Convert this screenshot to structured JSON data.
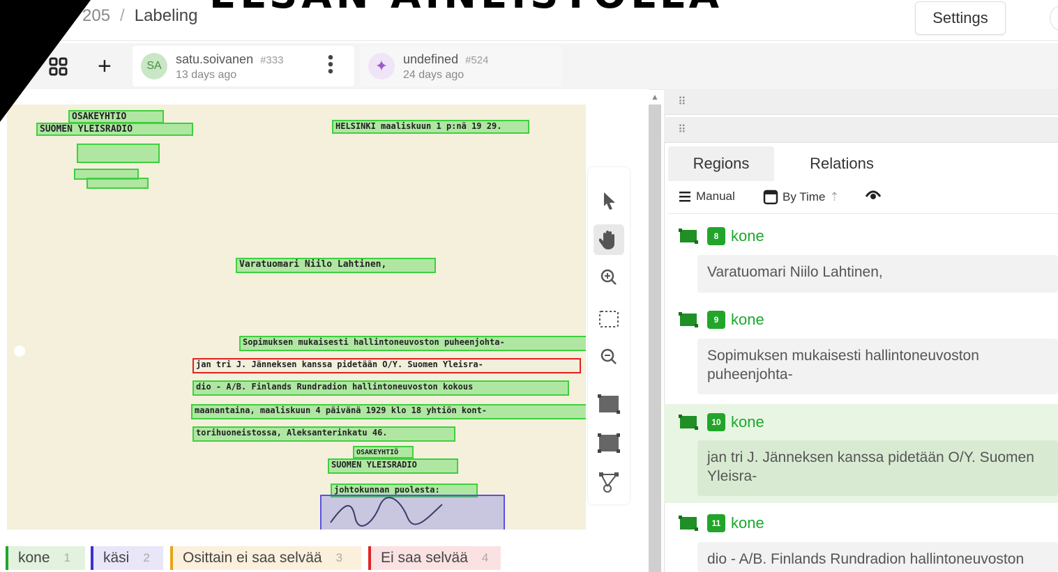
{
  "banner": "ELSAN AINEISTOLLA",
  "breadcrumb": {
    "project": "205",
    "separator": "/",
    "page": "Labeling"
  },
  "header": {
    "settings_label": "Settings"
  },
  "annotations": [
    {
      "initials": "SA",
      "user": "satu.soivanen",
      "id": "#333",
      "time": "13 days ago"
    },
    {
      "initials": "✦",
      "user": "undefined",
      "id": "#524",
      "time": "24 days ago"
    }
  ],
  "document": {
    "regions": [
      "OSAKEYHTIÖ",
      "SUOMEN YLEISRADIO",
      "HELSINKI maaliskuun 1 p:nä 19 29.",
      "Varatuomari Niilo Lahtinen,",
      "Sopimuksen mukaisesti hallintoneuvoston puheenjohta-",
      "jan tri J. Jänneksen kanssa pidetään O/Y. Suomen Yleisra-",
      "dio - A/B. Finlands Rundradion hallintoneuvoston kokous",
      "maanantaina, maaliskuun 4 päivänä 1929 klo 18 yhtiön kont-",
      "torihuoneistossa, Aleksanterinkatu 46.",
      "OSAKEYHTIÖ",
      "SUOMEN YLEISRADIO",
      "johtokunnan puolesta:"
    ]
  },
  "labels": [
    {
      "name": "kone",
      "hotkey": "1",
      "color": "#22a52a"
    },
    {
      "name": "käsi",
      "hotkey": "2",
      "color": "#3b2fd6"
    },
    {
      "name": "Osittain ei saa selvää",
      "hotkey": "3",
      "color": "#e8a317"
    },
    {
      "name": "Ei saa selvää",
      "hotkey": "4",
      "color": "#e02424"
    }
  ],
  "panel": {
    "tabs": [
      "Regions",
      "Relations"
    ],
    "sort": {
      "manual": "Manual",
      "by_time": "By Time"
    },
    "regions": [
      {
        "index": "8",
        "label": "kone",
        "text": "Varatuomari Niilo Lahtinen,"
      },
      {
        "index": "9",
        "label": "kone",
        "text": "Sopimuksen mukaisesti hallintoneuvoston puheenjohta-"
      },
      {
        "index": "10",
        "label": "kone",
        "text": "jan tri J. Jänneksen kanssa pidetään O/Y. Suomen Yleisra-"
      },
      {
        "index": "11",
        "label": "kone",
        "text": "dio - A/B. Finlands Rundradion hallintoneuvoston"
      }
    ]
  }
}
